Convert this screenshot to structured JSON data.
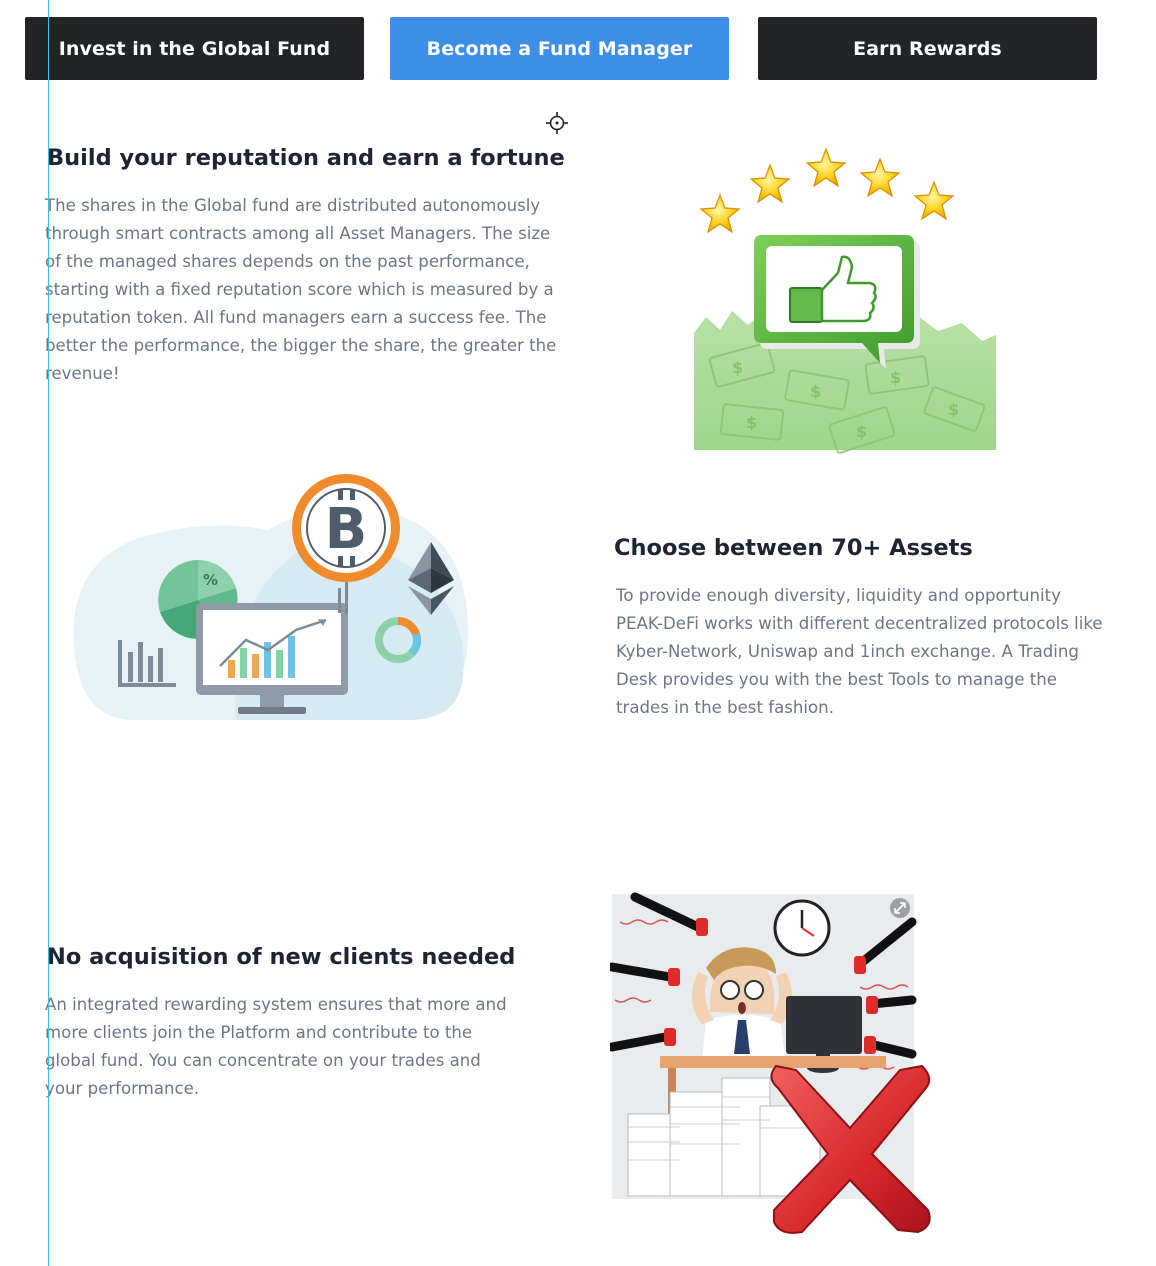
{
  "tabs": {
    "invest": "Invest in the Global Fund",
    "manager": "Become a Fund Manager",
    "rewards": "Earn Rewards"
  },
  "sections": {
    "reputation": {
      "title": "Build your reputation and earn a fortune",
      "body": "The shares in the Global fund are distributed autonomously through smart contracts among all Asset Managers. The size of the managed shares depends on the past performance, starting with a fixed reputation score which is measured by a reputation token. All fund managers earn a success fee. The better the performance, the bigger the share, the greater the revenue!"
    },
    "assets": {
      "title": "Choose between 70+ Assets",
      "body": "To provide enough diversity, liquidity and opportunity PEAK-DeFi works with different decentralized protocols like Kyber-Network, Uniswap and 1inch exchange. A Trading Desk provides you with the best Tools to manage the trades in the best fashion."
    },
    "clients": {
      "title": "No acquisition of new clients needed",
      "body": "An integrated rewarding system ensures that more and more clients  join the Platform and contribute to the global fund. You can concentrate on your trades and your performance."
    }
  },
  "illustrations": {
    "bitcoin_glyph": "B",
    "percent_glyph": "%"
  },
  "colors": {
    "tab_dark": "#222426",
    "tab_active": "#3c8ee6",
    "heading": "#1d2433",
    "body_text": "#6b7687",
    "guide_line": "#33c3ee"
  }
}
